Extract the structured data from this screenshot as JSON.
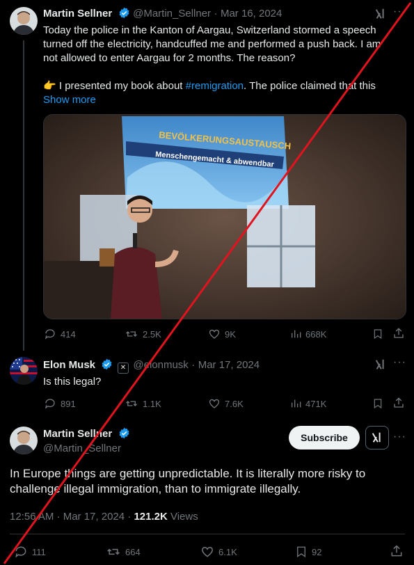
{
  "tweet1": {
    "name": "Martin Sellner",
    "handle": "@Martin_Sellner",
    "sep": "·",
    "date": "Mar 16, 2024",
    "text_line1": "Today the police in the Kanton of Aargau, Switzerland stormed a speech",
    "text_line2": "turned off the electricity, handcuffed me and performed a push back. I am",
    "text_line3": "not allowed to enter Aargau for 2 months. The reason?",
    "emoji": "👉",
    "text_line4_a": " I presented my book about ",
    "hashtag": "#remigration",
    "text_line4_b": ". The police claimed that this",
    "show_more": "Show more",
    "slide_title": "BEVÖLKERUNGSAUSTAUSCH",
    "slide_subtitle": "Menschengemacht & abwendbar",
    "stats": {
      "replies": "414",
      "reposts": "2.5K",
      "likes": "9K",
      "views": "668K"
    }
  },
  "tweet2": {
    "name": "Elon Musk",
    "handle": "@elonmusk",
    "sep": "·",
    "date": "Mar 17, 2024",
    "text": "Is this legal?",
    "stats": {
      "replies": "891",
      "reposts": "1.1K",
      "likes": "7.6K",
      "views": "471K"
    }
  },
  "tweet3": {
    "name": "Martin Sellner",
    "handle": "@Martin_Sellner",
    "subscribe_label": "Subscribe",
    "text_line1": "In Europe things are getting unpredictable. It is literally more risky to",
    "text_line2": "challenge illegal immigration, than to immigrate illegally.",
    "time": "12:56 AM · Mar 17, 2024 · ",
    "views_count": "121.2K",
    "views_label": " Views",
    "stats": {
      "replies": "111",
      "reposts": "664",
      "likes": "6.1K",
      "bookmarks": "92"
    }
  },
  "colors": {
    "accent": "#1d9bf0",
    "muted": "#71767b",
    "slash": "#e0141e"
  }
}
